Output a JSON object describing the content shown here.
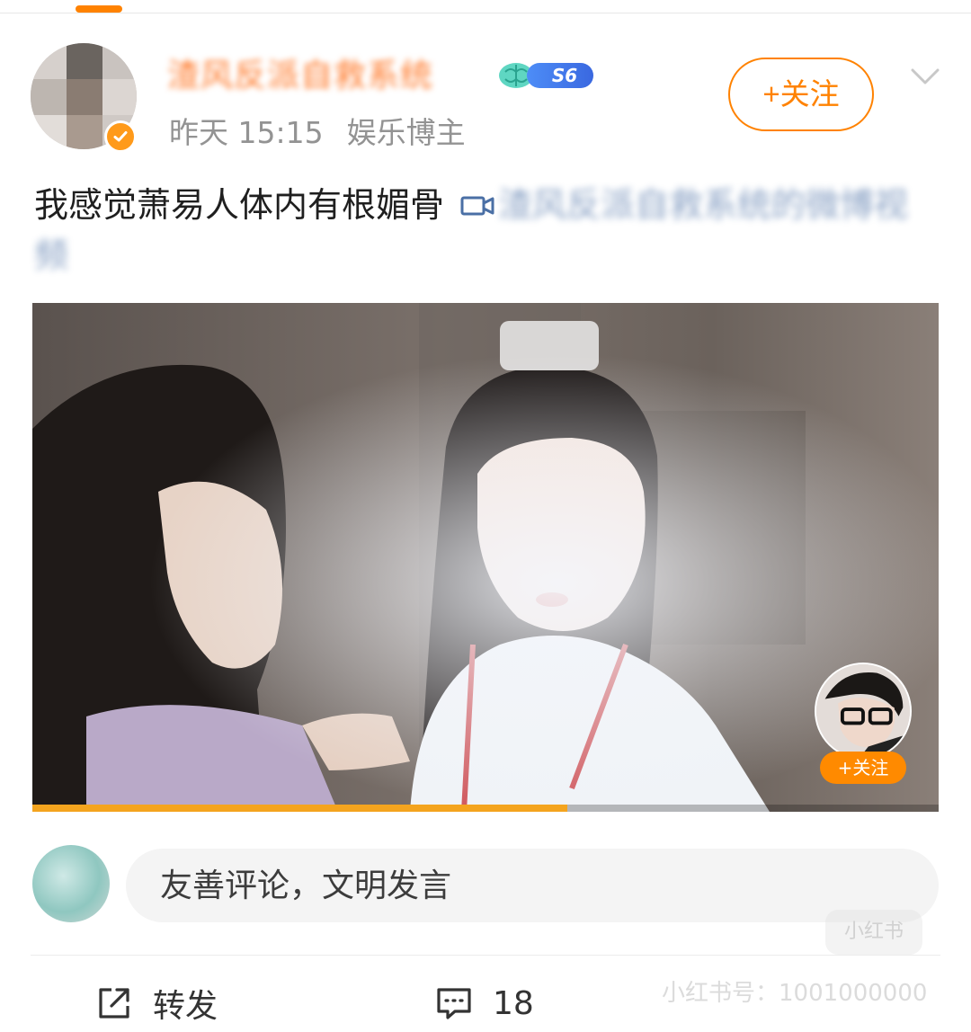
{
  "post": {
    "username": "渣风反派自救系统",
    "level": "S6",
    "time": "昨天 15:15",
    "source": "娱乐博主",
    "follow_label": "+关注",
    "text": "我感觉萧易人体内有根媚骨",
    "video_tag": "渣风反派自救系统的微博视频"
  },
  "video": {
    "progress": 0.59,
    "follow_label": "+关注"
  },
  "comment": {
    "placeholder": "友善评论，文明发言"
  },
  "actions": {
    "repost_label": "转发",
    "comment_count": "18"
  },
  "watermark": {
    "text": "小红书号：1001000000",
    "logo_text": "小红书"
  },
  "colors": {
    "accent": "#ff8200",
    "progress": "#f4a41e",
    "level_badge": "#3a68e0"
  }
}
